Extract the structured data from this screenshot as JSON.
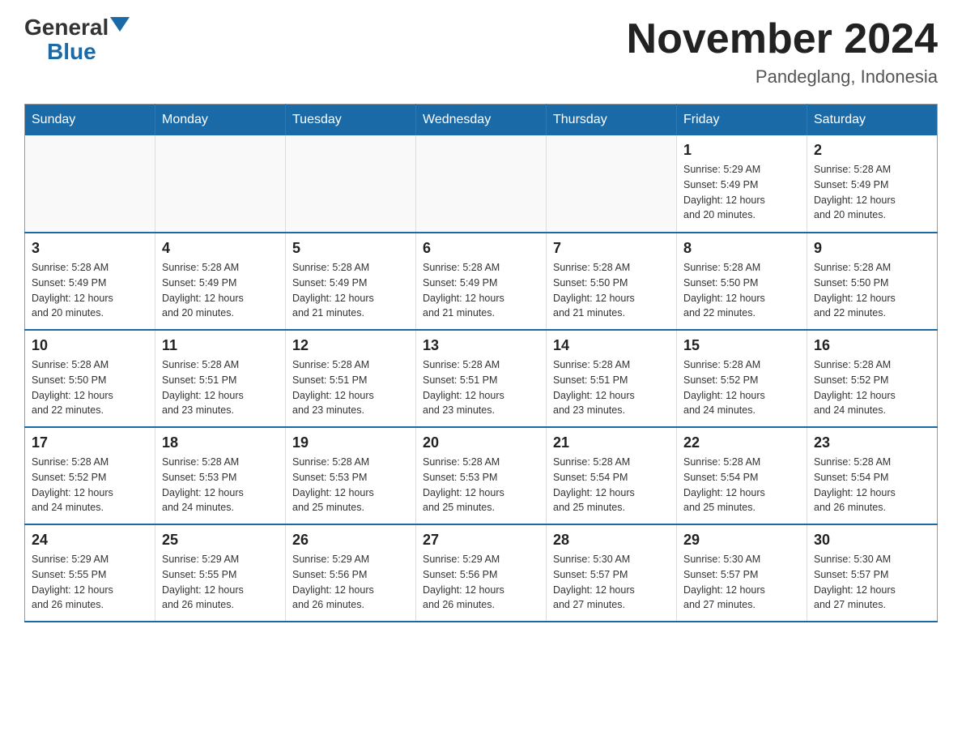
{
  "logo": {
    "general": "General",
    "blue": "Blue"
  },
  "header": {
    "month": "November 2024",
    "location": "Pandeglang, Indonesia"
  },
  "weekdays": [
    "Sunday",
    "Monday",
    "Tuesday",
    "Wednesday",
    "Thursday",
    "Friday",
    "Saturday"
  ],
  "weeks": [
    [
      {
        "day": "",
        "info": ""
      },
      {
        "day": "",
        "info": ""
      },
      {
        "day": "",
        "info": ""
      },
      {
        "day": "",
        "info": ""
      },
      {
        "day": "",
        "info": ""
      },
      {
        "day": "1",
        "info": "Sunrise: 5:29 AM\nSunset: 5:49 PM\nDaylight: 12 hours\nand 20 minutes."
      },
      {
        "day": "2",
        "info": "Sunrise: 5:28 AM\nSunset: 5:49 PM\nDaylight: 12 hours\nand 20 minutes."
      }
    ],
    [
      {
        "day": "3",
        "info": "Sunrise: 5:28 AM\nSunset: 5:49 PM\nDaylight: 12 hours\nand 20 minutes."
      },
      {
        "day": "4",
        "info": "Sunrise: 5:28 AM\nSunset: 5:49 PM\nDaylight: 12 hours\nand 20 minutes."
      },
      {
        "day": "5",
        "info": "Sunrise: 5:28 AM\nSunset: 5:49 PM\nDaylight: 12 hours\nand 21 minutes."
      },
      {
        "day": "6",
        "info": "Sunrise: 5:28 AM\nSunset: 5:49 PM\nDaylight: 12 hours\nand 21 minutes."
      },
      {
        "day": "7",
        "info": "Sunrise: 5:28 AM\nSunset: 5:50 PM\nDaylight: 12 hours\nand 21 minutes."
      },
      {
        "day": "8",
        "info": "Sunrise: 5:28 AM\nSunset: 5:50 PM\nDaylight: 12 hours\nand 22 minutes."
      },
      {
        "day": "9",
        "info": "Sunrise: 5:28 AM\nSunset: 5:50 PM\nDaylight: 12 hours\nand 22 minutes."
      }
    ],
    [
      {
        "day": "10",
        "info": "Sunrise: 5:28 AM\nSunset: 5:50 PM\nDaylight: 12 hours\nand 22 minutes."
      },
      {
        "day": "11",
        "info": "Sunrise: 5:28 AM\nSunset: 5:51 PM\nDaylight: 12 hours\nand 23 minutes."
      },
      {
        "day": "12",
        "info": "Sunrise: 5:28 AM\nSunset: 5:51 PM\nDaylight: 12 hours\nand 23 minutes."
      },
      {
        "day": "13",
        "info": "Sunrise: 5:28 AM\nSunset: 5:51 PM\nDaylight: 12 hours\nand 23 minutes."
      },
      {
        "day": "14",
        "info": "Sunrise: 5:28 AM\nSunset: 5:51 PM\nDaylight: 12 hours\nand 23 minutes."
      },
      {
        "day": "15",
        "info": "Sunrise: 5:28 AM\nSunset: 5:52 PM\nDaylight: 12 hours\nand 24 minutes."
      },
      {
        "day": "16",
        "info": "Sunrise: 5:28 AM\nSunset: 5:52 PM\nDaylight: 12 hours\nand 24 minutes."
      }
    ],
    [
      {
        "day": "17",
        "info": "Sunrise: 5:28 AM\nSunset: 5:52 PM\nDaylight: 12 hours\nand 24 minutes."
      },
      {
        "day": "18",
        "info": "Sunrise: 5:28 AM\nSunset: 5:53 PM\nDaylight: 12 hours\nand 24 minutes."
      },
      {
        "day": "19",
        "info": "Sunrise: 5:28 AM\nSunset: 5:53 PM\nDaylight: 12 hours\nand 25 minutes."
      },
      {
        "day": "20",
        "info": "Sunrise: 5:28 AM\nSunset: 5:53 PM\nDaylight: 12 hours\nand 25 minutes."
      },
      {
        "day": "21",
        "info": "Sunrise: 5:28 AM\nSunset: 5:54 PM\nDaylight: 12 hours\nand 25 minutes."
      },
      {
        "day": "22",
        "info": "Sunrise: 5:28 AM\nSunset: 5:54 PM\nDaylight: 12 hours\nand 25 minutes."
      },
      {
        "day": "23",
        "info": "Sunrise: 5:28 AM\nSunset: 5:54 PM\nDaylight: 12 hours\nand 26 minutes."
      }
    ],
    [
      {
        "day": "24",
        "info": "Sunrise: 5:29 AM\nSunset: 5:55 PM\nDaylight: 12 hours\nand 26 minutes."
      },
      {
        "day": "25",
        "info": "Sunrise: 5:29 AM\nSunset: 5:55 PM\nDaylight: 12 hours\nand 26 minutes."
      },
      {
        "day": "26",
        "info": "Sunrise: 5:29 AM\nSunset: 5:56 PM\nDaylight: 12 hours\nand 26 minutes."
      },
      {
        "day": "27",
        "info": "Sunrise: 5:29 AM\nSunset: 5:56 PM\nDaylight: 12 hours\nand 26 minutes."
      },
      {
        "day": "28",
        "info": "Sunrise: 5:30 AM\nSunset: 5:57 PM\nDaylight: 12 hours\nand 27 minutes."
      },
      {
        "day": "29",
        "info": "Sunrise: 5:30 AM\nSunset: 5:57 PM\nDaylight: 12 hours\nand 27 minutes."
      },
      {
        "day": "30",
        "info": "Sunrise: 5:30 AM\nSunset: 5:57 PM\nDaylight: 12 hours\nand 27 minutes."
      }
    ]
  ]
}
